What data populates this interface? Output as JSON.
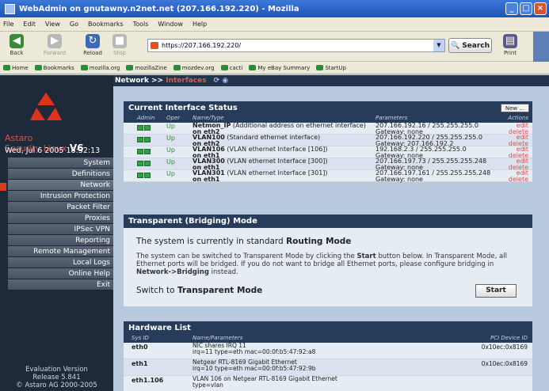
{
  "window": {
    "title": "WebAdmin on gnutawny.n2net.net (207.166.192.220) - Mozilla",
    "controls": [
      "_",
      "□",
      "×"
    ]
  },
  "menubar": {
    "items": [
      "File",
      "Edit",
      "View",
      "Go",
      "Bookmarks",
      "Tools",
      "Window",
      "Help"
    ]
  },
  "toolbar": {
    "back": "Back",
    "forward": "Forward",
    "reload": "Reload",
    "stop": "Stop",
    "url": "https://207.166.192.220/",
    "search": "Search",
    "print": "Print"
  },
  "bookmarks": [
    "Home",
    "Bookmarks",
    "mozilla.org",
    "mozillaZine",
    "mozdev.org",
    "cacti",
    "My eBay Summary",
    "StartUp"
  ],
  "sidebar": {
    "brand_line1": "Astaro",
    "brand_line2": "Security Linux",
    "brand_version": "V6",
    "date": "Wed, Jul 6 2005 18:32:13",
    "items": [
      "System",
      "Definitions",
      "Network",
      "Intrusion Protection",
      "Packet Filter",
      "Proxies",
      "IPSec VPN",
      "Reporting",
      "Remote Management",
      "Local Logs",
      "Online Help",
      "Exit"
    ],
    "active": "Network",
    "footer_line1": "Evaluation Version",
    "footer_line2": "Release 5.841",
    "footer_line3": "© Astaro AG 2000-2005"
  },
  "breadcrumb": {
    "parent": "Network >>",
    "current": "Interfaces",
    "nav": "⟳ ◉"
  },
  "interfaces": {
    "title": "Current Interface Status",
    "new_button": "New ...",
    "columns": {
      "admin": "Admin",
      "oper": "Oper",
      "name": "Name/Type",
      "params": "Parameters",
      "actions": "Actions"
    },
    "rows": [
      {
        "name": "Netmon_IP",
        "type": "(Additional address on ethernet interface)",
        "on": "on eth2",
        "oper": "Up",
        "param1": "207.166.192.16 / 255.255.255.0",
        "param2": "Gateway: none",
        "edit": "edit",
        "delete": "delete"
      },
      {
        "name": "VLAN100",
        "type": "(Standard ethernet interface)",
        "on": "on eth2",
        "oper": "Up",
        "param1": "207.166.192.220 / 255.255.255.0",
        "param2": "Gateway: 207.166.192.2",
        "edit": "edit",
        "delete": "delete"
      },
      {
        "name": "VLAN106",
        "type": "(VLAN ethernet Interface [106])",
        "on": "on eth1",
        "oper": "Up",
        "param1": "192.168.2.3 / 255.255.255.0",
        "param2": "Gateway: none",
        "edit": "edit",
        "delete": "delete"
      },
      {
        "name": "VLAN300",
        "type": "(VLAN ethernet Interface [300])",
        "on": "on eth1",
        "oper": "Up",
        "param1": "207.166.197.73 / 255.255.255.248",
        "param2": "Gateway: none",
        "edit": "edit",
        "delete": "delete"
      },
      {
        "name": "VLAN301",
        "type": "(VLAN ethernet Interface [301])",
        "on": "on eth1",
        "oper": "Up",
        "param1": "207.166.197.161 / 255.255.255.248",
        "param2": "Gateway: none",
        "edit": "edit",
        "delete": "delete"
      }
    ]
  },
  "transparent": {
    "title": "Transparent (Bridging) Mode",
    "status_prefix": "The system is currently in standard",
    "status_mode": "Routing Mode",
    "desc_part1": "The system can be switched to Transparent Mode by clicking the",
    "desc_start": "Start",
    "desc_part2": "button below. In Transparent Mode, all Ethernet ports will be bridged. If you do not want to bridge all Ethernet ports, please configure bridging in",
    "desc_link": "Network->Bridging",
    "desc_end": "instead.",
    "switch_prefix": "Switch to",
    "switch_mode": "Transparent Mode",
    "start_button": "Start"
  },
  "hardware": {
    "title": "Hardware List",
    "columns": {
      "sysid": "Sys ID",
      "name": "Name/Parameters",
      "pci": "PCI Device ID"
    },
    "rows": [
      {
        "id": "eth0",
        "line1": "NIC shares IRQ 11",
        "line2": "irq=11  type=eth  mac=00:0f:b5:47:92:a8",
        "pci": "0x10ec:0x8169"
      },
      {
        "id": "eth1",
        "line1": "Netgear RTL-8169 Gigabit Ethernet",
        "line2": "irq=10  type=eth  mac=00:0f:b5:47:92:9b",
        "pci": "0x10ec:0x8169"
      },
      {
        "id": "eth1.106",
        "line1": "VLAN 106 on Netgear RTL-8169 Gigabit Ethernet",
        "line2": "type=vlan",
        "pci": ""
      }
    ]
  }
}
